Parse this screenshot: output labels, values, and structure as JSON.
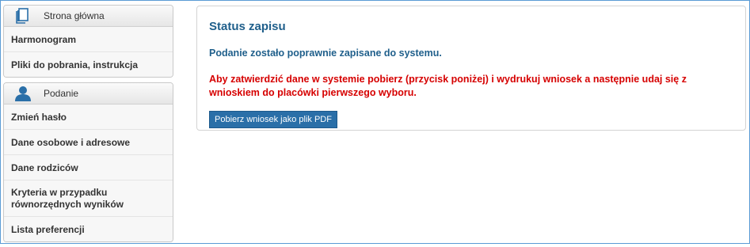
{
  "sidebar": {
    "home_panel": {
      "title": "Strona główna",
      "items": [
        {
          "label": "Harmonogram"
        },
        {
          "label": "Pliki do pobrania, instrukcja"
        }
      ]
    },
    "application_panel": {
      "title": "Podanie",
      "items": [
        {
          "label": "Zmień hasło"
        },
        {
          "label": "Dane osobowe i adresowe"
        },
        {
          "label": "Dane rodziców"
        },
        {
          "label_line1": "Kryteria w przypadku",
          "label_line2": "równorzędnych wyników"
        },
        {
          "label": "Lista preferencji"
        }
      ]
    }
  },
  "main": {
    "title": "Status zapisu",
    "success_message": "Podanie zostało poprawnie zapisane do systemu.",
    "warning_message": "Aby zatwierdzić dane w systemie pobierz (przycisk poniżej) i wydrukuj wniosek a następnie udaj się z wnioskiem do placówki pierwszego wyboru.",
    "download_button_label": "Pobierz wniosek jako plik PDF"
  },
  "colors": {
    "title_blue": "#1f5f8b",
    "warning_red": "#d60000",
    "button_blue": "#2a6fa8",
    "frame_border": "#5b9bd5"
  },
  "icons": {
    "home": "document-icon",
    "application": "user-icon"
  }
}
